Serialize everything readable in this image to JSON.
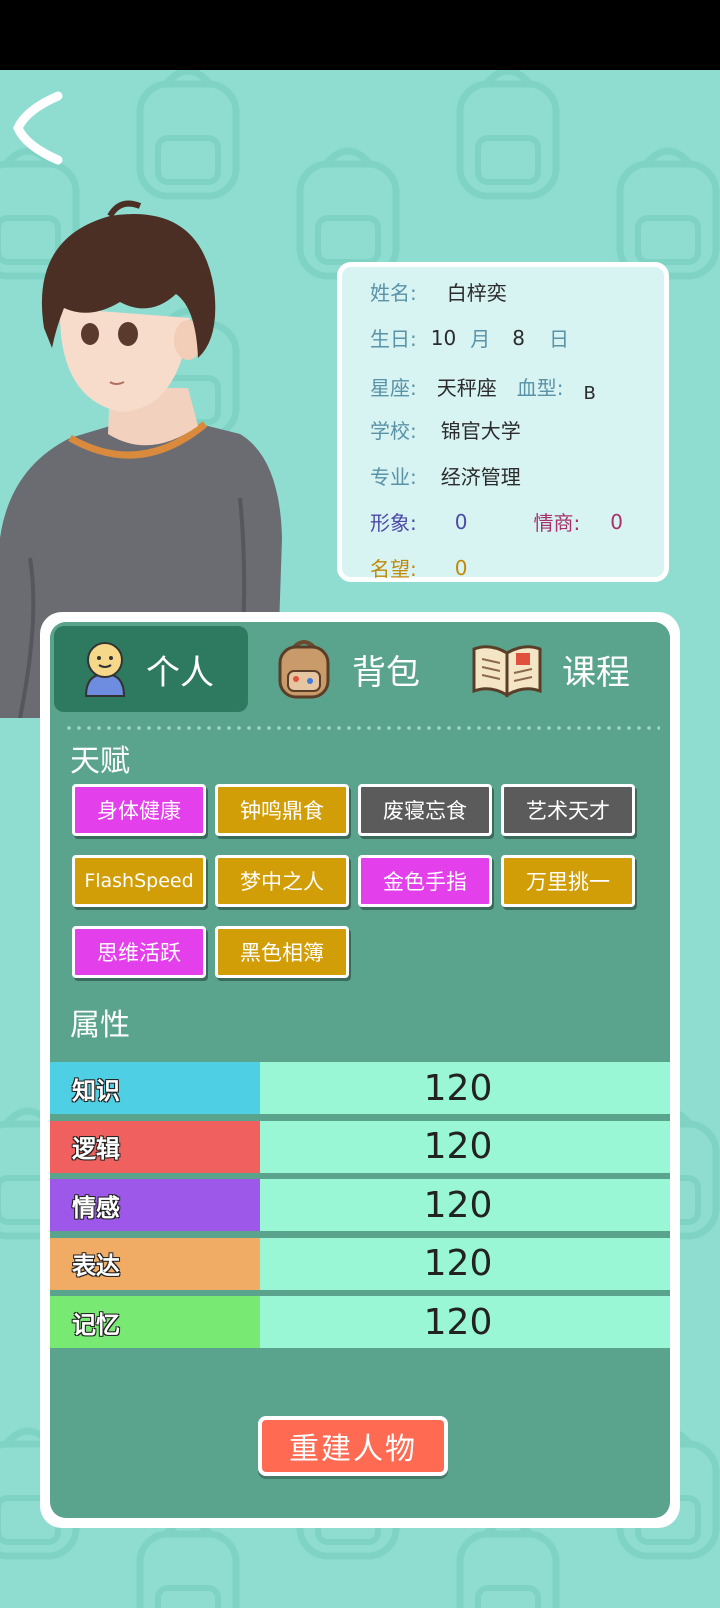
{
  "colors": {
    "background": "#8fddd0",
    "panel": "#5aa38c",
    "tab_active": "#2e7a60",
    "tag_magenta": "#e340ec",
    "tag_gold": "#d29e08",
    "tag_gray": "#5b5b5b",
    "attr_value_bg": "#9af7d6",
    "rebuild_button": "#ff6b52"
  },
  "profile": {
    "name_label": "姓名:",
    "name": "白梓奕",
    "birthday_label": "生日:",
    "birth_month": "10",
    "month_unit": "月",
    "birth_day": "8",
    "day_unit": "日",
    "zodiac_label": "星座:",
    "zodiac": "天秤座",
    "blood_label": "血型:",
    "blood": "B",
    "school_label": "学校:",
    "school": "锦官大学",
    "major_label": "专业:",
    "major": "经济管理",
    "image_label": "形象:",
    "image_value": "0",
    "eq_label": "情商:",
    "eq_value": "0",
    "fame_label": "名望:",
    "fame_value": "0"
  },
  "tabs": [
    {
      "label": "个人",
      "icon": "person-icon"
    },
    {
      "label": "背包",
      "icon": "backpack-icon"
    },
    {
      "label": "课程",
      "icon": "book-icon"
    }
  ],
  "talents_title": "天赋",
  "talents": [
    {
      "label": "身体健康",
      "color": "#e340ec"
    },
    {
      "label": "钟鸣鼎食",
      "color": "#d29e08"
    },
    {
      "label": "废寝忘食",
      "color": "#5b5b5b"
    },
    {
      "label": "艺术天才",
      "color": "#5b5b5b"
    },
    {
      "label": "FlashSpeed",
      "color": "#d29e08"
    },
    {
      "label": "梦中之人",
      "color": "#d29e08"
    },
    {
      "label": "金色手指",
      "color": "#e340ec"
    },
    {
      "label": "万里挑一",
      "color": "#d29e08"
    },
    {
      "label": "思维活跃",
      "color": "#e340ec"
    },
    {
      "label": "黑色相簿",
      "color": "#d29e08"
    }
  ],
  "attributes_title": "属性",
  "attributes": [
    {
      "name": "知识",
      "value": "120",
      "color": "#4fcfe3"
    },
    {
      "name": "逻辑",
      "value": "120",
      "color": "#f0605e"
    },
    {
      "name": "情感",
      "value": "120",
      "color": "#9d58ea"
    },
    {
      "name": "表达",
      "value": "120",
      "color": "#f0ac64"
    },
    {
      "name": "记忆",
      "value": "120",
      "color": "#78ea73"
    }
  ],
  "rebuild_label": "重建人物"
}
